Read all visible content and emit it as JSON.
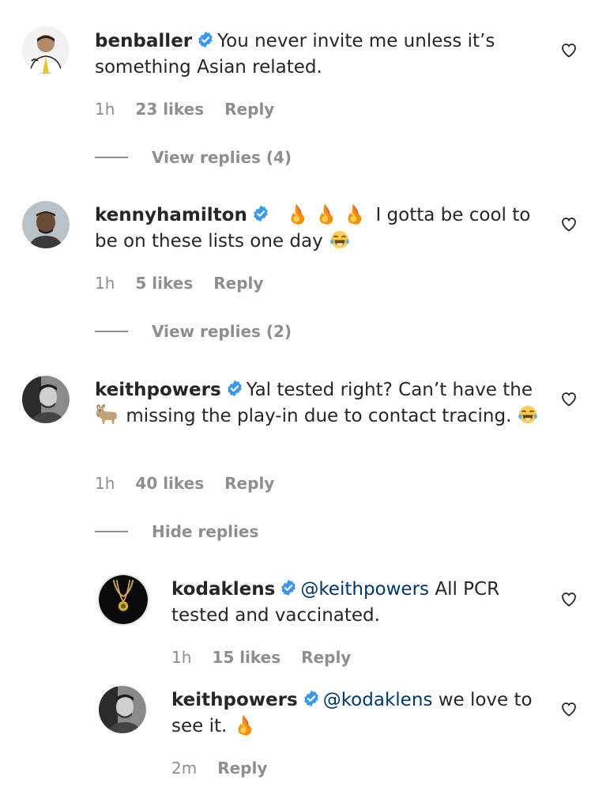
{
  "comments": [
    {
      "username": "benballer",
      "text": "You never invite me unless it’s something Asian related.",
      "time": "1h",
      "likes": "23 likes",
      "reply_label": "Reply",
      "replies_toggle": "View replies (4)"
    },
    {
      "username": "kennyhamilton",
      "text": "I gotta be cool to be on these lists one day",
      "time": "1h",
      "likes": "5 likes",
      "reply_label": "Reply",
      "replies_toggle": "View replies (2)"
    },
    {
      "username": "keithpowers",
      "text_part1": "Yal tested right? Can’t have the",
      "text_part2": "missing the play-in due to contact tracing.",
      "time": "1h",
      "likes": "40 likes",
      "reply_label": "Reply",
      "replies_toggle": "Hide replies"
    }
  ],
  "replies": [
    {
      "username": "kodaklens",
      "mention": "@keithpowers",
      "text": "All PCR tested and vaccinated.",
      "time": "1h",
      "likes": "15 likes",
      "reply_label": "Reply"
    },
    {
      "username": "keithpowers",
      "mention": "@kodaklens",
      "text": "we love to see it.",
      "time": "2m",
      "reply_label": "Reply"
    }
  ],
  "icons": {
    "verified": "verified-badge-icon",
    "like": "heart-outline-icon",
    "fire": "fire-emoji",
    "laugh": "tears-of-joy-emoji",
    "goat": "goat-emoji"
  },
  "colors": {
    "text": "#262626",
    "secondary": "#8e8e8e",
    "mention": "#00376b",
    "verified": "#3897f0"
  }
}
